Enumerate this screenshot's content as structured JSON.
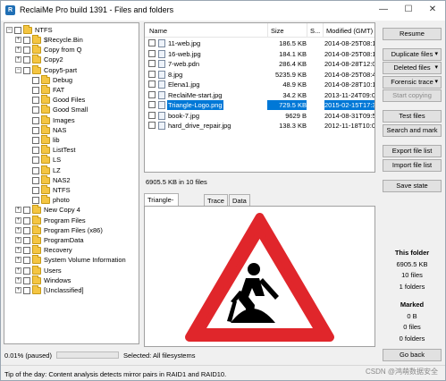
{
  "window": {
    "title": "ReclaiMe Pro build 1391 - Files and folders",
    "app_icon": "R"
  },
  "window_controls": {
    "minimize": "—",
    "restore": "☐",
    "close": "✕"
  },
  "tree": {
    "expanded_glyph": "−",
    "collapsed_glyph": "+",
    "root": "NTFS",
    "level1_a": [
      "$Recycle.Bin",
      "Copy from Q",
      "Copy2",
      "Copy5-part"
    ],
    "level2": [
      "Debug",
      "FAT",
      "Good Files",
      "Good Small",
      "Images",
      "NAS",
      "lib",
      "ListTest",
      "LS",
      "LZ",
      "NAS2",
      "NTFS",
      "photo"
    ],
    "level1_b": [
      "New Copy 4",
      "Program Files",
      "Program Files (x86)",
      "ProgramData",
      "Recovery",
      "System Volume Information",
      "Users",
      "Windows",
      "[Unclassified]"
    ]
  },
  "file_list": {
    "columns": {
      "name": "Name",
      "size": "Size",
      "s": "S...",
      "modified": "Modified (GMT)"
    },
    "rows": [
      {
        "name": "11-web.jpg",
        "size": "186.5 KB",
        "date": "2014-08-25T08:1"
      },
      {
        "name": "16-web.jpg",
        "size": "184.1 KB",
        "date": "2014-08-25T08:1"
      },
      {
        "name": "7-web.pdn",
        "size": "286.4 KB",
        "date": "2014-08-28T12:0"
      },
      {
        "name": "8.jpg",
        "size": "5235.9 KB",
        "date": "2014-08-25T08:4"
      },
      {
        "name": "Elena1.jpg",
        "size": "48.9 KB",
        "date": "2014-08-28T10:1"
      },
      {
        "name": "ReclaiMe-start.jpg",
        "size": "34.2 KB",
        "date": "2013-11-24T09:0"
      },
      {
        "name": "Triangle-Logo.png",
        "size": "729.5 KB",
        "date": "2015-02-15T17:3",
        "selected": true
      },
      {
        "name": "book-7.jpg",
        "size": "9629 B",
        "date": "2014-08-31T09:5"
      },
      {
        "name": "hard_drive_repair.jpg",
        "size": "138.3 KB",
        "date": "2012-11-18T10:0"
      }
    ],
    "summary": "6905.5 KB in 10 files"
  },
  "preview_tabs": [
    "Triangle-Logo.png",
    "Trace",
    "Data view"
  ],
  "buttons": {
    "resume": "Resume",
    "duplicate_files": "Duplicate files",
    "deleted_files": "Deleted files",
    "forensic_trace": "Forensic trace",
    "start_copying": "Start copying",
    "test_files": "Test files",
    "search_and_mark": "Search and mark",
    "export_file_list": "Export file list",
    "import_file_list": "Import file list",
    "save_state": "Save state",
    "go_back": "Go back"
  },
  "this_folder": {
    "heading": "This folder",
    "size": "6905.5 KB",
    "files": "10 files",
    "folders": "1 folders"
  },
  "marked": {
    "heading": "Marked",
    "size": "0 B",
    "files": "0 files",
    "folders": "0 folders"
  },
  "status": {
    "progress_text": "0.01% (paused)",
    "progress_value": 0.0001,
    "selected": "Selected: All filesystems"
  },
  "tip": "Tip of the day: Content analysis detects mirror pairs in RAID1 and RAID10.",
  "watermark": "CSDN @鸿萌数据安全",
  "colors": {
    "selection": "#0078d7",
    "folder": "#f4c542",
    "warning_red": "#e0262b",
    "progress": "#06b025"
  }
}
